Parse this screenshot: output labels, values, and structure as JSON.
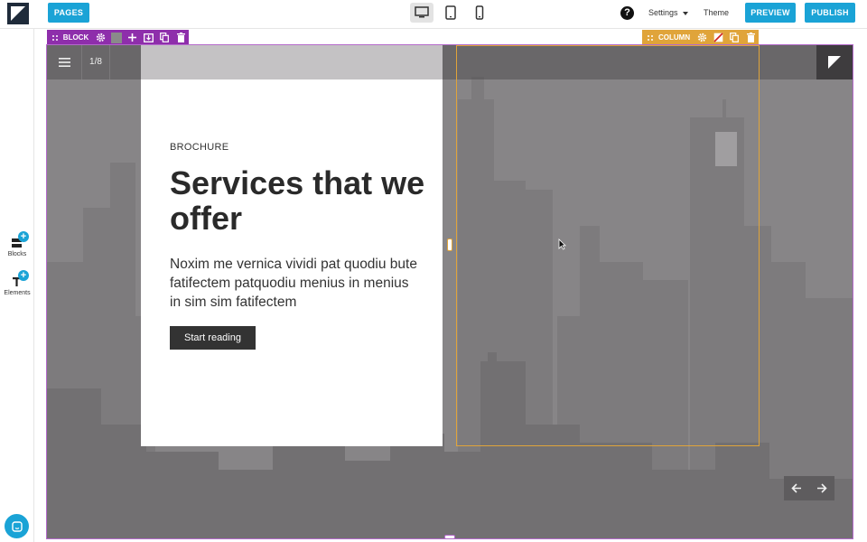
{
  "topbar": {
    "pages_label": "PAGES",
    "devices": [
      {
        "icon": "desktop-icon",
        "active": true
      },
      {
        "icon": "tablet-icon",
        "active": false
      },
      {
        "icon": "phone-icon",
        "active": false
      }
    ],
    "help_glyph": "?",
    "settings_label": "Settings",
    "theme_label": "Theme",
    "preview_label": "PREVIEW",
    "publish_label": "PUBLISH"
  },
  "sidebar": {
    "blocks_label": "Blocks",
    "elements_label": "Elements"
  },
  "block_toolbar": {
    "label": "BLOCK",
    "color": "#8e2eab",
    "icons": [
      "drag-handle-icon",
      "gear-icon",
      "color-swatch-icon",
      "plus-icon",
      "save-icon",
      "copy-icon",
      "trash-icon"
    ]
  },
  "column_toolbar": {
    "label": "COLUMN",
    "color": "#e0a43a",
    "icons": [
      "drag-handle-icon",
      "gear-icon",
      "no-fill-icon",
      "copy-icon",
      "trash-icon"
    ]
  },
  "slider": {
    "counter": "1/8"
  },
  "card": {
    "eyebrow": "BROCHURE",
    "headline": "Services that we offer",
    "body": "Noxim me vernica vividi pat quodiu bute fatifectem patquodiu menius in menius in sim sim fatifectem",
    "button_label": "Start reading"
  },
  "colors": {
    "accent": "#1aa3d6",
    "block_outline": "#b46acb",
    "column_outline": "#e0a43a",
    "canvas_bg": "#878587"
  }
}
